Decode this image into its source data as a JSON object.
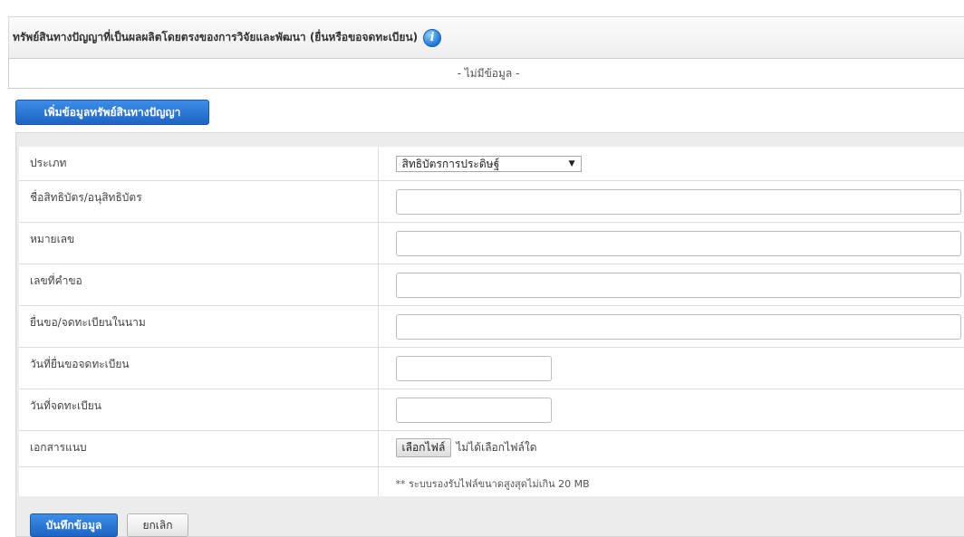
{
  "header": {
    "title": "ทรัพย์สินทางปัญญาที่เป็นผลผลิตโดยตรงของการวิจัยและพัฒนา (ยื่นหรือขอจดทะเบียน)",
    "info_icon": "info-icon"
  },
  "nodata_text": "- ไม่มีข้อมูล -",
  "add_button_label": "เพิ่มข้อมูลทรัพย์สินทางปัญญา",
  "form": {
    "type_label": "ประเภท",
    "type_value": "สิทธิบัตรการประดิษฐ์",
    "patent_name_label": "ชื่อสิทธิบัตร/อนุสิทธิบัตร",
    "number_label": "หมายเลข",
    "request_no_label": "เลขที่คำขอ",
    "applicant_label": "ยื่นขอ/จดทะเบียนในนาม",
    "filing_date_label": "วันที่ยื่นขอจดทะเบียน",
    "reg_date_label": "วันที่จดทะเบียน",
    "attachment_label": "เอกสารแนบ",
    "file_button_label": "เลือกไฟล์",
    "file_status": "ไม่ได้เลือกไฟล์ใด",
    "file_note": "** ระบบรองรับไฟล์ขนาดสูงสุดไม่เกิน 20 MB"
  },
  "actions": {
    "save_label": "บันทึกข้อมูล",
    "cancel_label": "ยกเลิก"
  },
  "colors": {
    "primary_button": "#1d64c4",
    "header_bg": "#eeeeee",
    "panel_bg": "#ececec"
  }
}
